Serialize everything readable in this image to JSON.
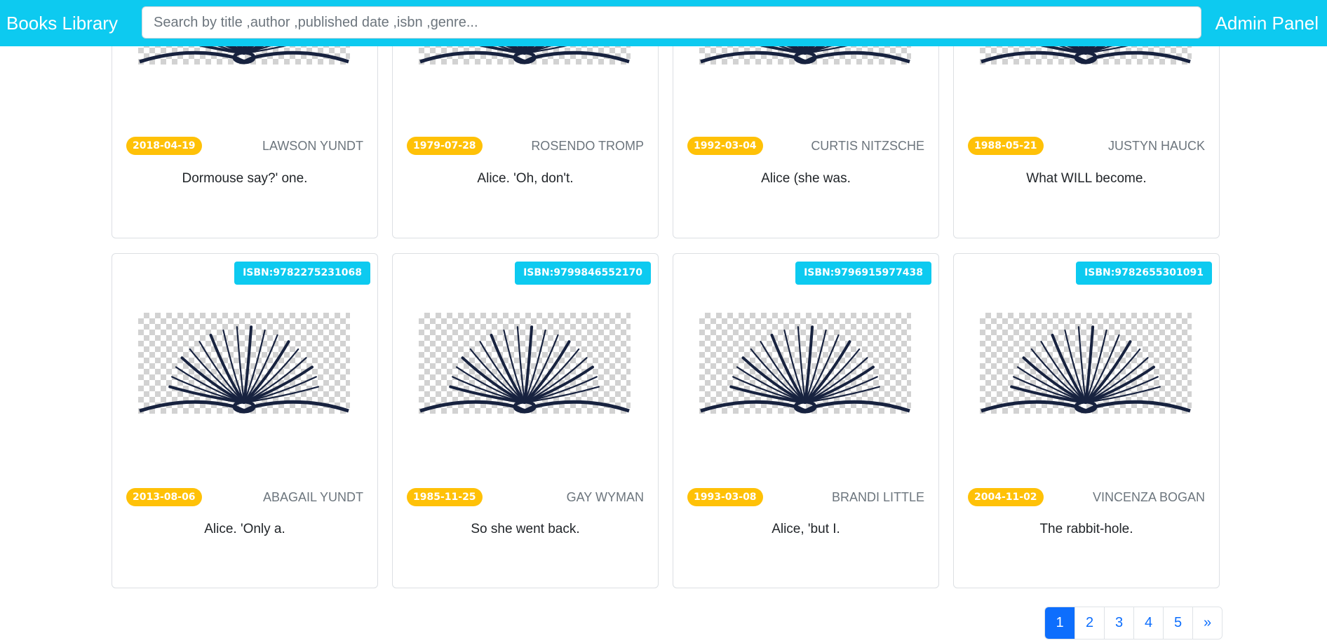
{
  "navbar": {
    "brand": "Books Library",
    "search_placeholder": "Search by title ,author ,published date ,isbn ,genre...",
    "admin_link": "Admin Panel",
    "color": "#0dcaf0"
  },
  "books": [
    {
      "isbn": "",
      "date": "2018-04-19",
      "author": "LAWSON YUNDT",
      "title": "Dormouse say?' one."
    },
    {
      "isbn": "",
      "date": "1979-07-28",
      "author": "ROSENDO TROMP",
      "title": "Alice. 'Oh, don't."
    },
    {
      "isbn": "",
      "date": "1992-03-04",
      "author": "CURTIS NITZSCHE",
      "title": "Alice (she was."
    },
    {
      "isbn": "",
      "date": "1988-05-21",
      "author": "JUSTYN HAUCK",
      "title": "What WILL become."
    },
    {
      "isbn": "ISBN:9782275231068",
      "date": "2013-08-06",
      "author": "ABAGAIL YUNDT",
      "title": "Alice. 'Only a."
    },
    {
      "isbn": "ISBN:9799846552170",
      "date": "1985-11-25",
      "author": "GAY WYMAN",
      "title": "So she went back."
    },
    {
      "isbn": "ISBN:9796915977438",
      "date": "1993-03-08",
      "author": "BRANDI LITTLE",
      "title": "Alice, 'but I."
    },
    {
      "isbn": "ISBN:9782655301091",
      "date": "2004-11-02",
      "author": "VINCENZA BOGAN",
      "title": "The rabbit-hole."
    }
  ],
  "book_image_icon": "open-book-icon",
  "pagination": {
    "pages": [
      "1",
      "2",
      "3",
      "4",
      "5"
    ],
    "next": "»",
    "active": "1"
  },
  "colors": {
    "date_badge": "#ffc107",
    "isbn_badge": "#0dcaf0",
    "page_active": "#0d6efd"
  }
}
